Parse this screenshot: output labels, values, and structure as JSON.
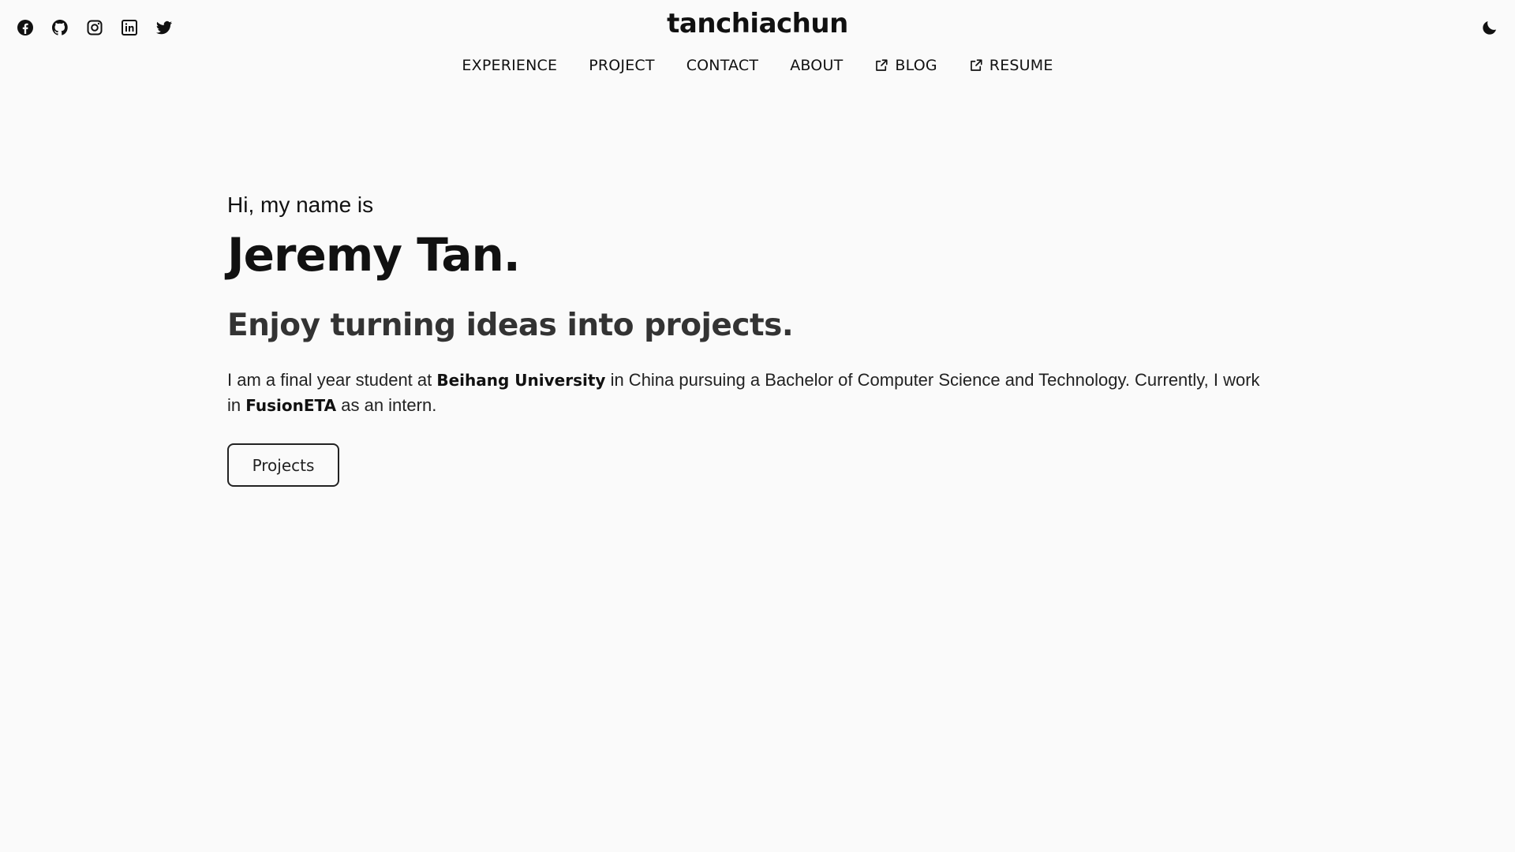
{
  "header": {
    "brand": "tanchiachun",
    "socials": [
      {
        "icon": "facebook-icon"
      },
      {
        "icon": "github-icon"
      },
      {
        "icon": "instagram-icon"
      },
      {
        "icon": "linkedin-icon"
      },
      {
        "icon": "twitter-icon"
      }
    ],
    "theme_toggle_icon": "moon-icon"
  },
  "nav": {
    "items": [
      {
        "label": "EXPERIENCE"
      },
      {
        "label": "PROJECT"
      },
      {
        "label": "CONTACT"
      },
      {
        "label": "ABOUT"
      },
      {
        "label": "BLOG",
        "icon": "external-link-icon"
      },
      {
        "label": "RESUME",
        "icon": "external-link-icon"
      }
    ]
  },
  "hero": {
    "greeting": "Hi, my name is",
    "name": "Jeremy Tan.",
    "tagline": "Enjoy turning ideas into projects.",
    "bio": {
      "part1": "I am a final year student at ",
      "university": "Beihang University",
      "part2": " in China pursuing a Bachelor of Computer Science and Technology. Currently, I work in ",
      "company": "FusionETA",
      "part3": " as an intern."
    },
    "button_label": "Projects"
  },
  "colors": {
    "background": "#fafafa",
    "text": "#111111",
    "tagline": "#333333"
  }
}
